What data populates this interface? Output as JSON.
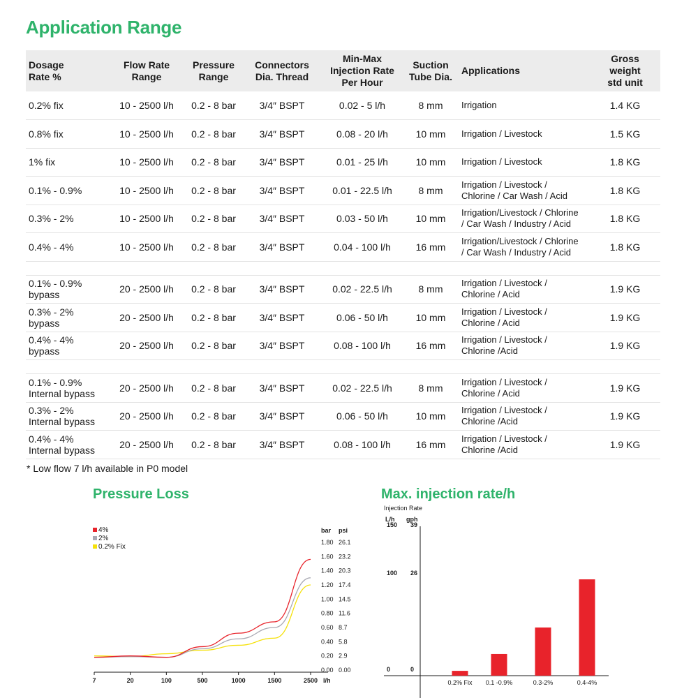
{
  "title": "Application Range",
  "table": {
    "headers": {
      "dosage": [
        "Dosage",
        "Rate %"
      ],
      "flow": [
        "Flow Rate",
        "Range"
      ],
      "pressure": [
        "Pressure",
        "Range"
      ],
      "connectors": [
        "Connectors",
        "Dia. Thread"
      ],
      "injection": [
        "Min-Max",
        "Injection Rate",
        "Per Hour"
      ],
      "tube": [
        "Suction",
        "Tube Dia."
      ],
      "applications": [
        "Applications"
      ],
      "weight": [
        "Gross",
        "weight",
        "std unit"
      ]
    },
    "rows": [
      {
        "dosage": [
          "0.2% fix"
        ],
        "flow": "10 - 2500 l/h",
        "pressure": "0.2 - 8 bar",
        "connectors": "3/4″  BSPT",
        "injection": "0.02 - 5 l/h",
        "tube": "8 mm",
        "applications": [
          "Irrigation"
        ],
        "weight": "1.4 KG"
      },
      {
        "dosage": [
          "0.8% fix"
        ],
        "flow": "10 - 2500 l/h",
        "pressure": "0.2 - 8 bar",
        "connectors": "3/4″  BSPT",
        "injection": "0.08 - 20 l/h",
        "tube": "10 mm",
        "applications": [
          "Irrigation / Livestock"
        ],
        "weight": "1.5 KG"
      },
      {
        "dosage": [
          "1% fix"
        ],
        "flow": "10 - 2500 l/h",
        "pressure": "0.2 - 8 bar",
        "connectors": "3/4″  BSPT",
        "injection": "0.01 - 25 l/h",
        "tube": "10 mm",
        "applications": [
          "Irrigation / Livestock"
        ],
        "weight": "1.8 KG"
      },
      {
        "dosage": [
          "0.1% - 0.9%"
        ],
        "flow": "10 - 2500 l/h",
        "pressure": "0.2 - 8 bar",
        "connectors": "3/4″  BSPT",
        "injection": "0.01 - 22.5 l/h",
        "tube": "8 mm",
        "applications": [
          "Irrigation / Livestock /",
          "Chlorine / Car Wash / Acid"
        ],
        "weight": "1.8 KG"
      },
      {
        "dosage": [
          "0.3% - 2%"
        ],
        "flow": "10 - 2500 l/h",
        "pressure": "0.2 - 8 bar",
        "connectors": "3/4″  BSPT",
        "injection": "0.03 - 50 l/h",
        "tube": "10 mm",
        "applications": [
          "Irrigation/Livestock / Chlorine",
          "/ Car Wash / Industry / Acid"
        ],
        "weight": "1.8 KG"
      },
      {
        "dosage": [
          "0.4% - 4%"
        ],
        "flow": "10 - 2500 l/h",
        "pressure": "0.2 - 8 bar",
        "connectors": "3/4″  BSPT",
        "injection": "0.04 - 100 l/h",
        "tube": "16 mm",
        "applications": [
          "Irrigation/Livestock / Chlorine",
          "/ Car Wash / Industry / Acid"
        ],
        "weight": "1.8 KG"
      },
      {
        "gap": true
      },
      {
        "dosage": [
          "0.1% - 0.9%",
          "bypass"
        ],
        "flow": "20 - 2500 l/h",
        "pressure": "0.2 - 8 bar",
        "connectors": "3/4″  BSPT",
        "injection": "0.02 - 22.5 l/h",
        "tube": "8 mm",
        "applications": [
          "Irrigation / Livestock /",
          "Chlorine / Acid"
        ],
        "weight": "1.9 KG"
      },
      {
        "dosage": [
          "0.3% - 2%",
          "bypass"
        ],
        "flow": "20 - 2500 l/h",
        "pressure": "0.2 - 8 bar",
        "connectors": "3/4″  BSPT",
        "injection": "0.06 - 50 l/h",
        "tube": "10 mm",
        "applications": [
          "Irrigation / Livestock /",
          "Chlorine / Acid"
        ],
        "weight": "1.9 KG"
      },
      {
        "dosage": [
          "0.4% - 4%",
          "bypass"
        ],
        "flow": "20 - 2500 l/h",
        "pressure": "0.2 - 8 bar",
        "connectors": "3/4″  BSPT",
        "injection": "0.08 - 100 l/h",
        "tube": "16 mm",
        "applications": [
          "Irrigation / Livestock /",
          "Chlorine /Acid"
        ],
        "weight": "1.9 KG"
      },
      {
        "gap": true
      },
      {
        "dosage": [
          "0.1% - 0.9%",
          "Internal bypass"
        ],
        "flow": "20 - 2500 l/h",
        "pressure": "0.2 - 8 bar",
        "connectors": "3/4″  BSPT",
        "injection": "0.02 - 22.5 l/h",
        "tube": "8 mm",
        "applications": [
          "Irrigation / Livestock /",
          "Chlorine / Acid"
        ],
        "weight": "1.9 KG"
      },
      {
        "dosage": [
          "0.3% - 2%",
          "Internal bypass"
        ],
        "flow": "20 - 2500 l/h",
        "pressure": "0.2 - 8 bar",
        "connectors": "3/4″  BSPT",
        "injection": "0.06 - 50 l/h",
        "tube": "10 mm",
        "applications": [
          "Irrigation / Livestock /",
          "Chlorine /Acid"
        ],
        "weight": "1.9 KG"
      },
      {
        "dosage": [
          "0.4% - 4%",
          "Internal bypass"
        ],
        "flow": "20 - 2500 l/h",
        "pressure": "0.2 - 8 bar",
        "connectors": "3/4″  BSPT",
        "injection": "0.08 - 100 l/h",
        "tube": "16 mm",
        "applications": [
          "Irrigation / Livestock /",
          "Chlorine /Acid"
        ],
        "weight": "1.9 KG"
      }
    ]
  },
  "footnote": "* Low flow 7 l/h available in P0 model",
  "colors": {
    "brand_green": "#2fb36b",
    "red": "#e8232b",
    "gray": "#a9a9b3",
    "yellow": "#f5e10a"
  },
  "chart_data": [
    {
      "type": "line",
      "title": "Pressure Loss",
      "x": [
        "7",
        "20",
        "100",
        "500",
        "1000",
        "1500",
        "2500"
      ],
      "xunit": "l/h",
      "y_axis_headers": [
        "bar",
        "psi"
      ],
      "y_ticks": [
        {
          "bar": "0.00",
          "psi": "0.00"
        },
        {
          "bar": "0.20",
          "psi": "2.9"
        },
        {
          "bar": "0.40",
          "psi": "5.8"
        },
        {
          "bar": "0.60",
          "psi": "8.7"
        },
        {
          "bar": "0.80",
          "psi": "11.6"
        },
        {
          "bar": "1.00",
          "psi": "14.5"
        },
        {
          "bar": "1.20",
          "psi": "17.4"
        },
        {
          "bar": "1.40",
          "psi": "20.3"
        },
        {
          "bar": "1.60",
          "psi": "23.2"
        },
        {
          "bar": "1.80",
          "psi": "26.1"
        }
      ],
      "ylim": [
        0,
        1.8
      ],
      "legend_position": "top-left",
      "series": [
        {
          "name": "4%",
          "color": "#e8232b",
          "values": [
            0.18,
            0.2,
            0.18,
            0.33,
            0.52,
            0.68,
            1.56
          ]
        },
        {
          "name": "2%",
          "color": "#a9a9b3",
          "values": [
            0.18,
            0.19,
            0.18,
            0.3,
            0.44,
            0.6,
            1.3
          ]
        },
        {
          "name": "0.2% Fix",
          "color": "#f5e10a",
          "values": [
            0.2,
            0.19,
            0.23,
            0.28,
            0.35,
            0.45,
            1.2
          ]
        }
      ]
    },
    {
      "type": "bar",
      "title": "Max. injection rate/h",
      "ylabel": "Injection Rate",
      "y_axis_headers": [
        "L/h",
        "gph"
      ],
      "y_ticks": [
        {
          "lh": "0",
          "gph": "0"
        },
        {
          "lh": "100",
          "gph": "26"
        },
        {
          "lh": "150",
          "gph": "39"
        }
      ],
      "ylim": [
        0,
        150
      ],
      "categories": [
        "0.2% Fix",
        "0.1 -0.9%",
        "0.3-2%",
        "0.4-4%"
      ],
      "values": [
        5,
        22.5,
        50,
        100
      ],
      "color": "#e8232b"
    }
  ]
}
